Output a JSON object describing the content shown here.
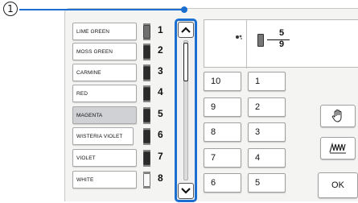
{
  "callout": {
    "number": "1"
  },
  "threads": [
    {
      "label": "LIME GREEN",
      "number": "1",
      "spool": "mid",
      "selected": false
    },
    {
      "label": "MOSS GREEN",
      "number": "2",
      "spool": "dark",
      "selected": false
    },
    {
      "label": "CARMINE",
      "number": "3",
      "spool": "dark",
      "selected": false
    },
    {
      "label": "RED",
      "number": "4",
      "spool": "dark",
      "selected": false
    },
    {
      "label": "MAGENTA",
      "number": "5",
      "spool": "dark",
      "selected": true
    },
    {
      "label": "WISTERIA VIOLET",
      "number": "6",
      "spool": "dark",
      "selected": false
    },
    {
      "label": "VIOLET",
      "number": "7",
      "spool": "dark",
      "selected": false
    },
    {
      "label": "WHITE",
      "number": "8",
      "spool": "light",
      "selected": false
    }
  ],
  "scrollbar": {
    "up_icon": "chevron-up-icon",
    "down_icon": "chevron-down-icon",
    "thumb_position": 0
  },
  "info": {
    "fraction_numerator": "5",
    "fraction_denominator": "9"
  },
  "order_grid": {
    "left_column": [
      "10",
      "9",
      "8",
      "7",
      "6"
    ],
    "right_column": [
      "1",
      "2",
      "3",
      "4",
      "5"
    ]
  },
  "buttons": {
    "ok_label": "OK",
    "hand_icon": "hand-icon",
    "trim_icon": "thread-trim-icon"
  },
  "colors": {
    "accent": "#1a6fd0",
    "selected_row": "#cfd1d4"
  }
}
